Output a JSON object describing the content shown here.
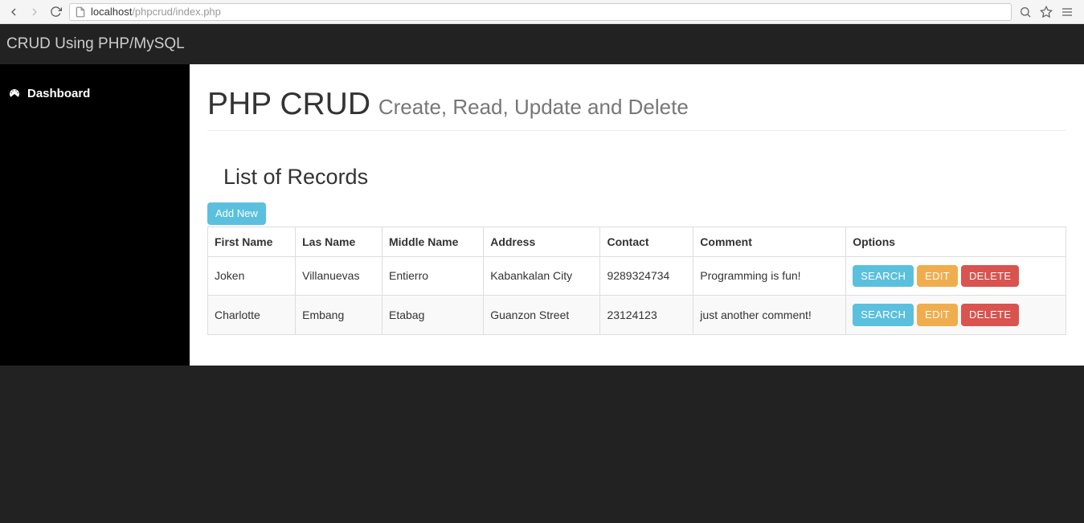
{
  "browser": {
    "url_host": "localhost",
    "url_path": "/phpcrud/index.php"
  },
  "navbar": {
    "brand": "CRUD Using PHP/MySQL"
  },
  "sidebar": {
    "items": [
      {
        "label": "Dashboard"
      }
    ]
  },
  "page": {
    "title": "PHP CRUD",
    "subtitle": "Create, Read, Update and Delete",
    "sub_header": "List of Records",
    "add_new_label": "Add New"
  },
  "table": {
    "headers": [
      "First Name",
      "Las Name",
      "Middle Name",
      "Address",
      "Contact",
      "Comment",
      "Options"
    ],
    "option_labels": {
      "search": "SEARCH",
      "edit": "EDIT",
      "delete": "DELETE"
    },
    "rows": [
      {
        "first": "Joken",
        "last": "Villanuevas",
        "middle": "Entierro",
        "address": "Kabankalan City",
        "contact": "9289324734",
        "comment": "Programming is fun!"
      },
      {
        "first": "Charlotte",
        "last": "Embang",
        "middle": "Etabag",
        "address": "Guanzon Street",
        "contact": "23124123",
        "comment": "just another comment!"
      }
    ]
  }
}
